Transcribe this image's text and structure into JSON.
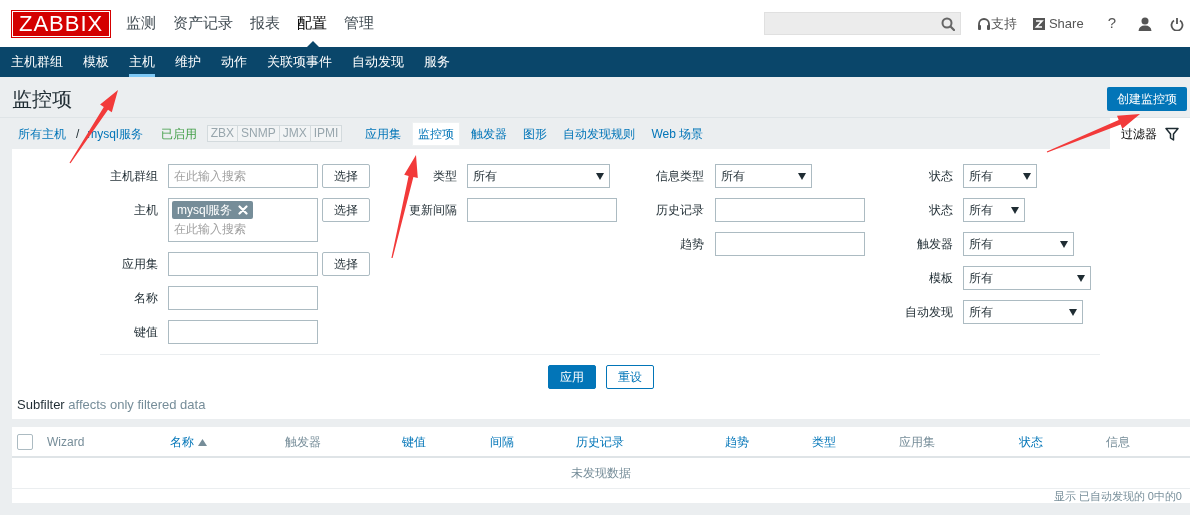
{
  "header": {
    "logo": "ZABBIX",
    "menu": [
      {
        "label": "监测",
        "selected": false
      },
      {
        "label": "资产记录",
        "selected": false
      },
      {
        "label": "报表",
        "selected": false
      },
      {
        "label": "配置",
        "selected": true
      },
      {
        "label": "管理",
        "selected": false
      }
    ],
    "support": "支持",
    "share": "Share",
    "help": "?"
  },
  "subnav": [
    {
      "label": "主机群组",
      "selected": false
    },
    {
      "label": "模板",
      "selected": false
    },
    {
      "label": "主机",
      "selected": true
    },
    {
      "label": "维护",
      "selected": false
    },
    {
      "label": "动作",
      "selected": false
    },
    {
      "label": "关联项事件",
      "selected": false
    },
    {
      "label": "自动发现",
      "selected": false
    },
    {
      "label": "服务",
      "selected": false
    }
  ],
  "page": {
    "title": "监控项",
    "create_button": "创建监控项"
  },
  "breadcrumb": {
    "all_hosts": "所有主机",
    "separator": "/",
    "host": "mysql服务",
    "status": "已启用",
    "availability": [
      {
        "label": "ZBX",
        "available": false
      },
      {
        "label": "SNMP",
        "available": false
      },
      {
        "label": "JMX",
        "available": false
      },
      {
        "label": "IPMI",
        "available": false
      }
    ],
    "tabs": [
      {
        "label": "应用集",
        "selected": false
      },
      {
        "label": "监控项",
        "selected": true
      },
      {
        "label": "触发器",
        "selected": false
      },
      {
        "label": "图形",
        "selected": false
      },
      {
        "label": "自动发现规则",
        "selected": false
      },
      {
        "label": "Web 场景",
        "selected": false
      }
    ]
  },
  "filter": {
    "tab": "过滤器",
    "expanded": true,
    "columns": [
      [
        {
          "label": "主机群组",
          "kind": "multiselect",
          "placeholder": "在此输入搜索",
          "button": "选择"
        },
        {
          "label": "主机",
          "kind": "multiselect",
          "tags": [
            "mysql服务"
          ],
          "placeholder": "在此输入搜索",
          "button": "选择"
        },
        {
          "label": "应用集",
          "kind": "text",
          "button": "选择"
        },
        {
          "label": "名称",
          "kind": "text"
        },
        {
          "label": "键值",
          "kind": "text"
        }
      ],
      [
        {
          "label": "类型",
          "kind": "select",
          "value": "所有"
        },
        {
          "label": "更新间隔",
          "kind": "text"
        }
      ],
      [
        {
          "label": "信息类型",
          "kind": "select",
          "value": "所有"
        },
        {
          "label": "历史记录",
          "kind": "text"
        },
        {
          "label": "趋势",
          "kind": "text"
        }
      ],
      [
        {
          "label": "状态",
          "kind": "select",
          "value": "所有"
        },
        {
          "label": "状态",
          "kind": "select",
          "value": "所有"
        },
        {
          "label": "触发器",
          "kind": "select",
          "value": "所有"
        },
        {
          "label": "模板",
          "kind": "select",
          "value": "所有"
        },
        {
          "label": "自动发现",
          "kind": "select",
          "value": "所有"
        }
      ]
    ],
    "apply": "应用",
    "reset": "重设",
    "subfilter": {
      "title": "Subfilter",
      "note": "affects only filtered data"
    }
  },
  "table": {
    "select_all": {
      "checked": false
    },
    "columns": [
      {
        "label": "Wizard",
        "sortable": false,
        "sorted": false
      },
      {
        "label": "名称",
        "sortable": true,
        "sorted": true
      },
      {
        "label": "触发器",
        "sortable": false,
        "sorted": false
      },
      {
        "label": "键值",
        "sortable": true,
        "sorted": false
      },
      {
        "label": "间隔",
        "sortable": true,
        "sorted": false
      },
      {
        "label": "历史记录",
        "sortable": true,
        "sorted": false
      },
      {
        "label": "趋势",
        "sortable": true,
        "sorted": false
      },
      {
        "label": "类型",
        "sortable": true,
        "sorted": false
      },
      {
        "label": "应用集",
        "sortable": false,
        "sorted": false
      },
      {
        "label": "状态",
        "sortable": true,
        "sorted": false
      },
      {
        "label": "信息",
        "sortable": false,
        "sorted": false
      }
    ],
    "empty_message": "未发现数据",
    "footer": "显示 已自动发现的 0中的0"
  }
}
